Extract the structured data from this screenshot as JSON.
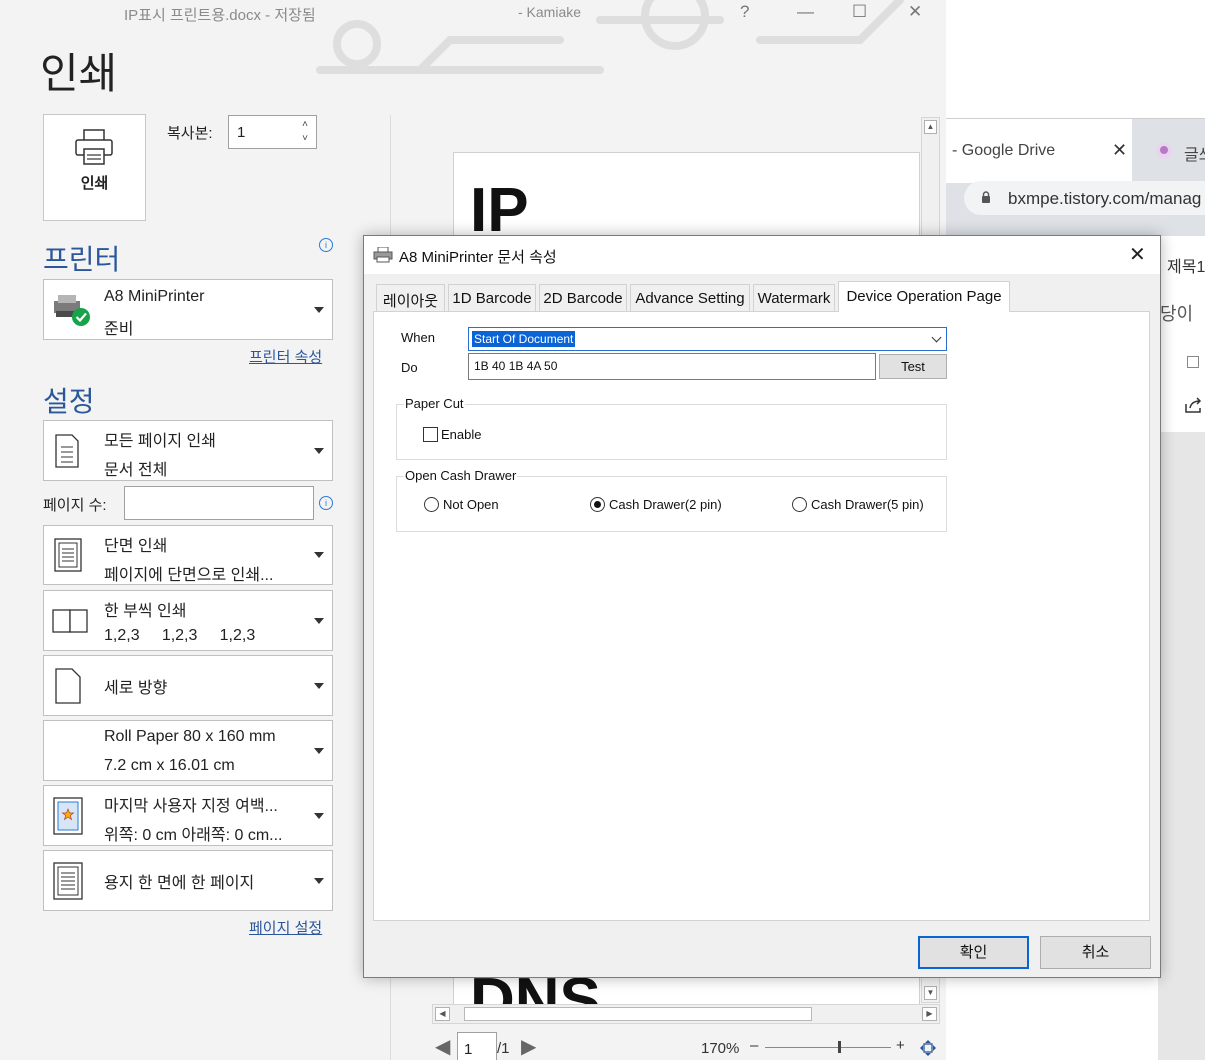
{
  "word": {
    "title": "IP표시 프린트용.docx - 저장됨",
    "user": "- Kamiake",
    "backstage_title": "인쇄",
    "print_button_label": "인쇄",
    "copies_label": "복사본:",
    "copies_value": "1",
    "printer_heading": "프린터",
    "printer_name": "A8 MiniPrinter",
    "printer_status": "준비",
    "printer_properties_link": "프린터 속성",
    "settings_heading": "설정",
    "settings": [
      {
        "line1": "모든 페이지 인쇄",
        "line2": "문서 전체"
      },
      {
        "line1": "단면 인쇄",
        "line2": "페이지에 단면으로 인쇄..."
      },
      {
        "line1": "한 부씩 인쇄",
        "line2": "1,2,3     1,2,3     1,2,3"
      },
      {
        "line1": "세로 방향",
        "line2": ""
      },
      {
        "line1": "Roll Paper 80 x 160 mm",
        "line2": "7.2 cm x 16.01 cm"
      },
      {
        "line1": "마지막 사용자 지정 여백...",
        "line2": "위쪽: 0 cm 아래쪽: 0 cm..."
      },
      {
        "line1": "용지 한 면에 한 페이지",
        "line2": ""
      }
    ],
    "pages_label": "페이지 수:",
    "pages_value": "",
    "page_setup_link": "페이지 설정",
    "preview_top_text": "IP",
    "preview_bottom_text": "DNS",
    "current_page": "1",
    "total_pages": "/1",
    "zoom_level": "170%",
    "zoom_minus": "–",
    "zoom_plus": "+"
  },
  "chrome": {
    "tab1_title": "- Google Drive",
    "tab1_close": "✕",
    "tab2_title": "글쓰",
    "url": "bxmpe.tistory.com/manag",
    "side_title": "제목1",
    "side_fragment": "당이"
  },
  "dialog": {
    "title": "A8 MiniPrinter 문서 속성",
    "close": "✕",
    "tabs": [
      "레이아웃",
      "1D Barcode",
      "2D Barcode",
      "Advance Setting",
      "Watermark",
      "Device Operation Page"
    ],
    "active_tab_index": 5,
    "when_label": "When",
    "when_value": "Start Of Document",
    "do_label": "Do",
    "do_value": "1B 40 1B 4A 50",
    "test_button": "Test",
    "paper_cut_group": "Paper Cut",
    "enable_label": "Enable",
    "enable_checked": false,
    "cash_drawer_group": "Open Cash Drawer",
    "cash_drawer_options": [
      "Not Open",
      "Cash Drawer(2 pin)",
      "Cash Drawer(5 pin)"
    ],
    "cash_drawer_selected_index": 1,
    "ok_button": "확인",
    "cancel_button": "취소"
  },
  "colors": {
    "accent": "#2b579a",
    "selection": "#0a64d6",
    "backstage_bg": "#f3f3f3"
  }
}
